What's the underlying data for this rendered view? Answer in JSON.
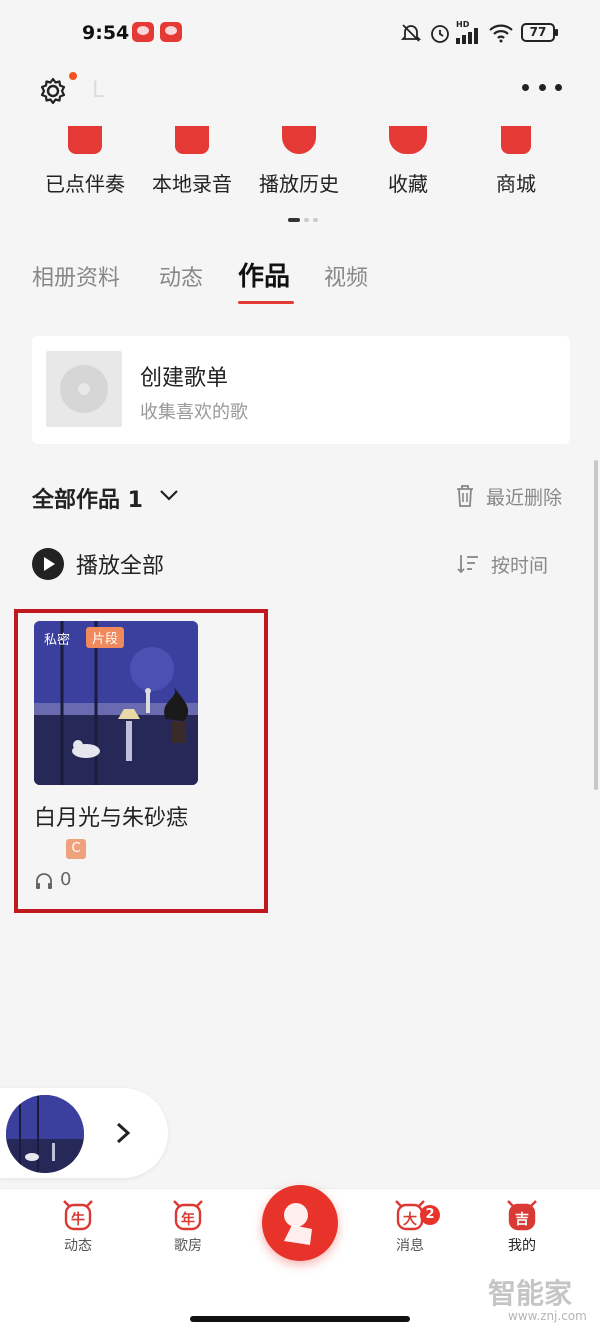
{
  "status_bar": {
    "time": "9:54",
    "battery": "77",
    "hd": "HD"
  },
  "header": {
    "name_initial": "L"
  },
  "quick_entries": [
    {
      "label": "已点伴奏",
      "icon": "checkmark-icon"
    },
    {
      "label": "本地录音",
      "icon": "music-note-icon"
    },
    {
      "label": "播放历史",
      "icon": "clock-icon"
    },
    {
      "label": "收藏",
      "icon": "heart-icon"
    },
    {
      "label": "商城",
      "icon": "shop-icon"
    }
  ],
  "tabs": [
    {
      "label": "相册资料",
      "active": false
    },
    {
      "label": "动态",
      "active": false
    },
    {
      "label": "作品",
      "active": true
    },
    {
      "label": "视频",
      "active": false
    }
  ],
  "create_playlist": {
    "title": "创建歌单",
    "subtitle": "收集喜欢的歌"
  },
  "works": {
    "title": "全部作品 1",
    "recent_delete": "最近删除",
    "play_all": "播放全部",
    "sort_label": "按时间",
    "items": [
      {
        "privacy_tag": "私密",
        "type_tag": "片段",
        "title": "白月光与朱砂痣",
        "grade": "C",
        "plays": "0"
      }
    ]
  },
  "bottom_nav": {
    "items": [
      {
        "label": "动态",
        "glyph": "牛"
      },
      {
        "label": "歌房",
        "glyph": "年"
      },
      {
        "label": "消息",
        "glyph": "大",
        "badge": "2"
      },
      {
        "label": "我的",
        "glyph": "吉"
      }
    ]
  },
  "watermark": {
    "text": "智能家",
    "url": "www.znj.com"
  },
  "colors": {
    "accent": "#e53935",
    "highlight_border": "#c0181f",
    "badge": "#f08a5d"
  }
}
